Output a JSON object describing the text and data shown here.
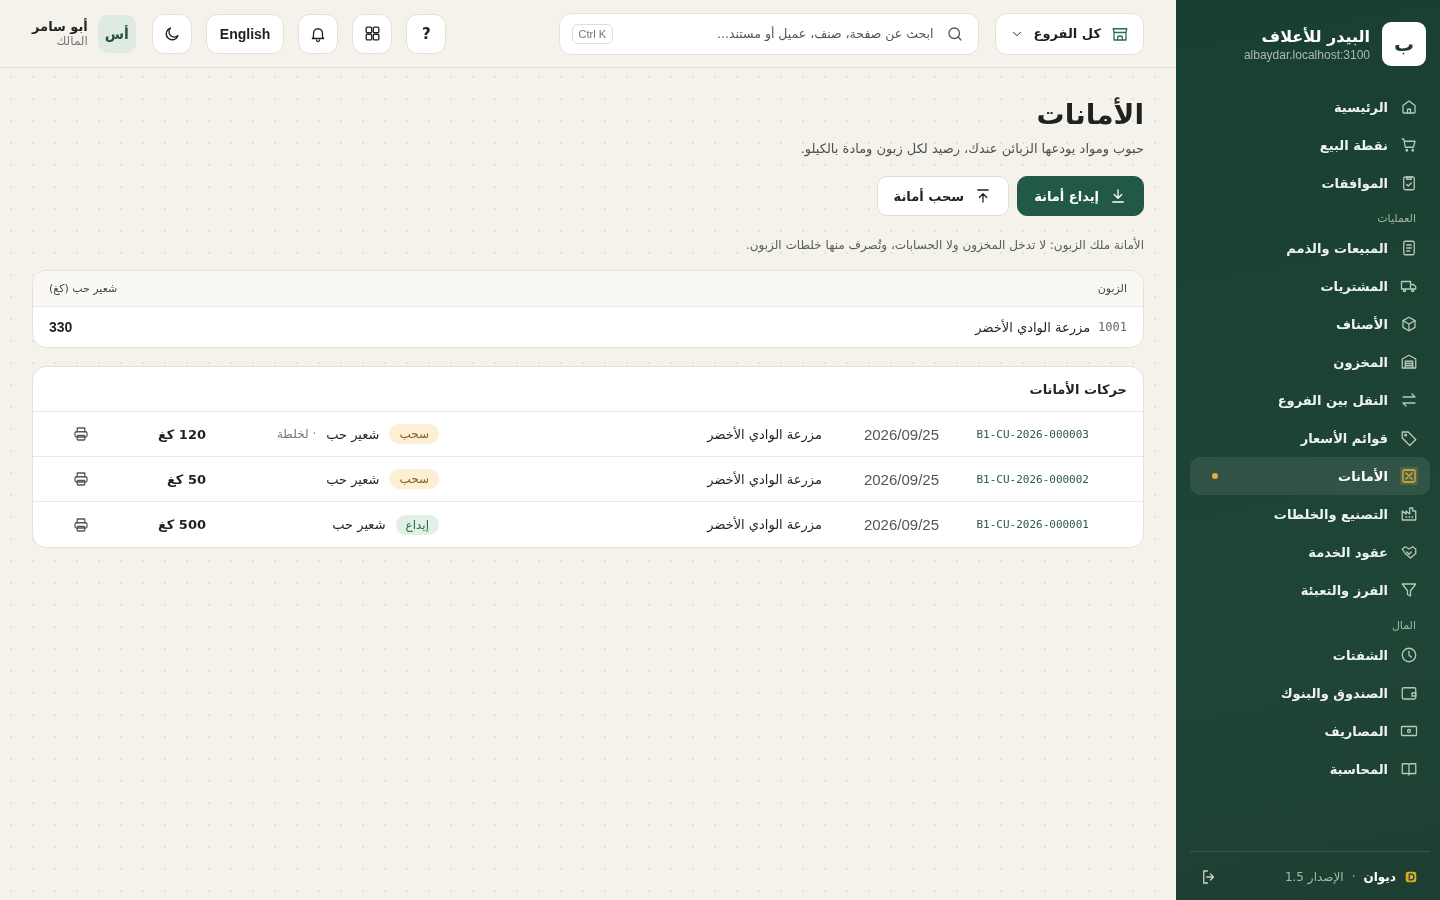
{
  "sidebar": {
    "brand": {
      "logo": "ب",
      "name": "البيدر للأعلاف",
      "host": "albaydar.localhost:3100"
    },
    "sections": [
      {
        "items": [
          {
            "label": "الرئيسية",
            "selected": false
          },
          {
            "label": "نقطة البيع",
            "selected": false
          },
          {
            "label": "الموافقات",
            "selected": false
          }
        ]
      },
      {
        "label": "العمليات",
        "items": [
          {
            "label": "المبيعات والذمم",
            "selected": false
          },
          {
            "label": "المشتريات",
            "selected": false
          },
          {
            "label": "الأصناف",
            "selected": false
          },
          {
            "label": "المخزون",
            "selected": false
          },
          {
            "label": "النقل بين الفروع",
            "selected": false
          },
          {
            "label": "قوائم الأسعار",
            "selected": false
          },
          {
            "label": "الأمانات",
            "selected": true
          },
          {
            "label": "التصنيع والخلطات",
            "selected": false
          },
          {
            "label": "عقود الخدمة",
            "selected": false
          },
          {
            "label": "الفرز والتعبئة",
            "selected": false
          }
        ]
      },
      {
        "label": "المال",
        "items": [
          {
            "label": "الشفتات",
            "selected": false
          },
          {
            "label": "الصندوق والبنوك",
            "selected": false
          },
          {
            "label": "المصاريف",
            "selected": false
          },
          {
            "label": "المحاسبة",
            "selected": false
          }
        ]
      }
    ],
    "footer": {
      "product": "ديوان",
      "separator": "·",
      "version": "الإصدار 1.5"
    }
  },
  "topbar": {
    "branch": "كل الفروع",
    "search": {
      "placeholder": "ابحث عن صفحة، صنف، عميل أو مستند...",
      "shortcut": "Ctrl K"
    },
    "help": "?",
    "language": "English",
    "user": {
      "initials": "أس",
      "name": "أبو سامر",
      "role": "المالك"
    }
  },
  "page": {
    "title": "الأمانات",
    "subtitle": "حبوب ومواد يودعها الزبائن عندك، رصيد لكل زبون ومادة بالكيلو.",
    "actions": [
      {
        "kind": "deposit",
        "label": "إيداع أمانة"
      },
      {
        "kind": "withdraw",
        "label": "سحب أمانة"
      }
    ],
    "note": "الأمانة ملك الزبون: لا تدخل المخزون ولا الحسابات، وتُصرف منها خلطات الزبون."
  },
  "balances": {
    "columns": [
      "الزبون",
      "شعير حب (كغ)"
    ],
    "rows": [
      {
        "code": "1001",
        "customer": "مزرعة الوادي الأخضر",
        "quantity": "330"
      }
    ]
  },
  "movements": {
    "title": "حركات الأمانات",
    "rows": [
      {
        "ref": "B1-CU-2026-000003",
        "date": "2026/09/25",
        "customer": "مزرعة الوادي الأخضر",
        "type": {
          "kind": "withdraw",
          "label": "سحب"
        },
        "item": "شعير حب",
        "note": "· لخلطة",
        "quantity": "120 كغ"
      },
      {
        "ref": "B1-CU-2026-000002",
        "date": "2026/09/25",
        "customer": "مزرعة الوادي الأخضر",
        "type": {
          "kind": "withdraw",
          "label": "سحب"
        },
        "item": "شعير حب",
        "quantity": "50 كغ"
      },
      {
        "ref": "B1-CU-2026-000001",
        "date": "2026/09/25",
        "customer": "مزرعة الوادي الأخضر",
        "type": {
          "kind": "deposit",
          "label": "إيداع"
        },
        "item": "شعير حب",
        "quantity": "500 كغ"
      }
    ]
  }
}
